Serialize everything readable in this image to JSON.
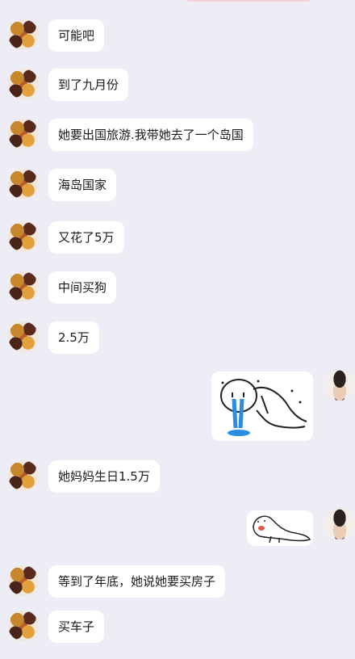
{
  "messages": [
    {
      "side": "left",
      "text": "可能吧"
    },
    {
      "side": "left",
      "text": "到了九月份"
    },
    {
      "side": "left",
      "text": "她要出国旅游.我带她去了一个岛国"
    },
    {
      "side": "left",
      "text": "海岛国家"
    },
    {
      "side": "left",
      "text": "又花了5万"
    },
    {
      "side": "left",
      "text": "中间买狗"
    },
    {
      "side": "left",
      "text": "2.5万"
    },
    {
      "side": "right",
      "sticker": "crying-stick-figure-sticker"
    },
    {
      "side": "left",
      "text": "她妈妈生日1.5万"
    },
    {
      "side": "right",
      "sticker": "seal-sticker"
    },
    {
      "side": "left",
      "text": "等到了年底，她说她要买房子"
    },
    {
      "side": "left",
      "text": "买车子"
    }
  ],
  "colors": {
    "background": "#eeedf6",
    "bubble": "#ffffff",
    "text": "#1a1a1a"
  }
}
